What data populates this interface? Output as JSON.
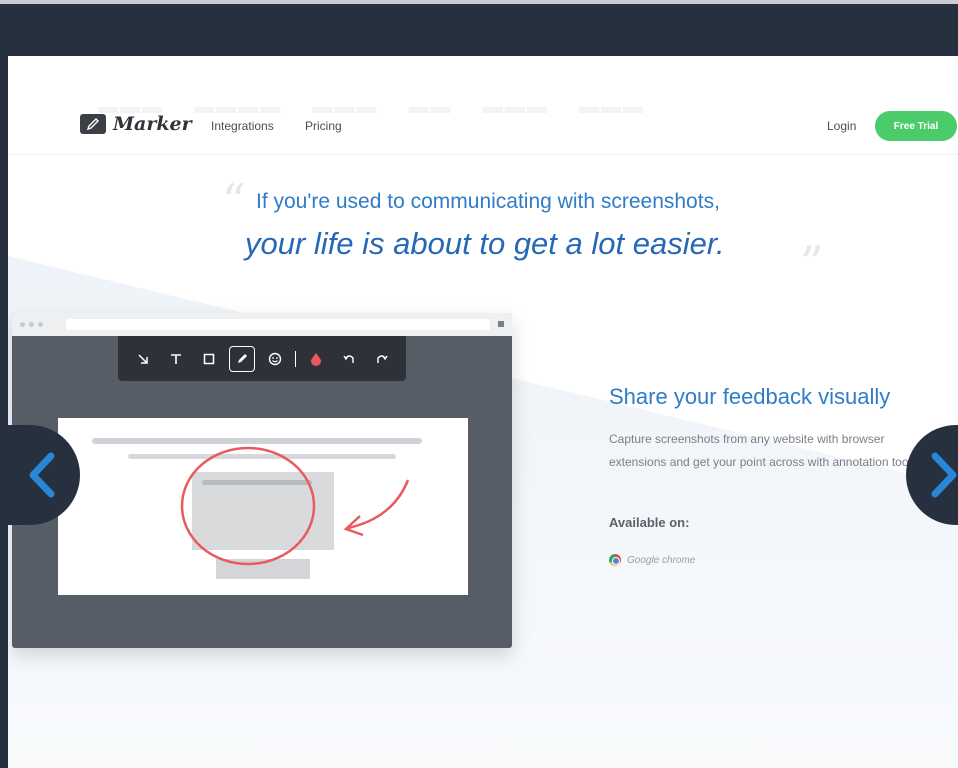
{
  "header": {
    "logo_text": "Marker",
    "nav": [
      "Integrations",
      "Pricing"
    ],
    "login_label": "Login",
    "cta_label": "Free Trial"
  },
  "hero": {
    "quote_open": "“",
    "quote_close": "”",
    "line1": "If you're used to communicating with screenshots,",
    "line2": "your life is about to get a lot easier."
  },
  "feature": {
    "title": "Share your feedback visually",
    "description": "Capture screenshots from any website with browser extensions and get your point across with annotation tools.",
    "available_label": "Available on:",
    "platform": "Google chrome"
  },
  "toolbar": {
    "tools": [
      "arrow-icon",
      "text-icon",
      "rectangle-icon",
      "pen-icon",
      "emoji-icon",
      "color-icon",
      "undo-icon",
      "redo-icon"
    ],
    "active_tool": "pen-icon",
    "annotation_color": "#e85a60"
  },
  "colors": {
    "accent_blue": "#2f7cc9",
    "cta_green": "#4ccb6a",
    "frame_dark": "#26303f"
  }
}
